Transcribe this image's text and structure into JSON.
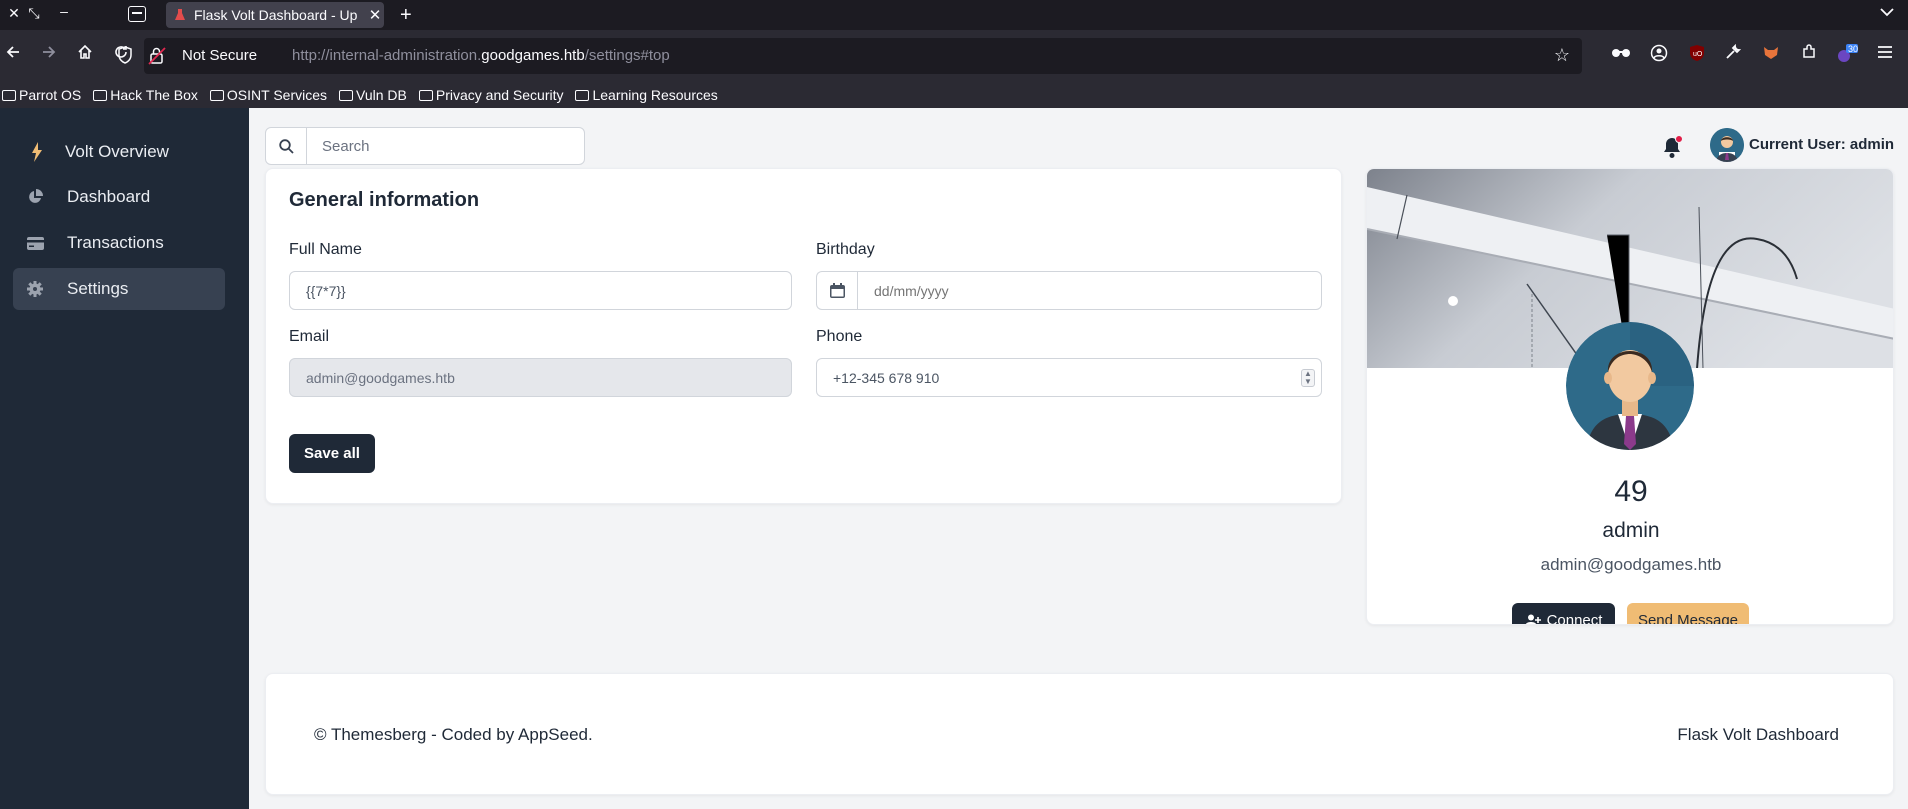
{
  "browser": {
    "tab_title": "Flask Volt Dashboard - Up",
    "security_label": "Not Secure",
    "url_prefix": "http://internal-administration.",
    "url_domain": "goodgames.htb",
    "url_suffix": "/settings#top",
    "extension_badge": "30",
    "bookmarks": [
      "Parrot OS",
      "Hack The Box",
      "OSINT Services",
      "Vuln DB",
      "Privacy and Security",
      "Learning Resources"
    ]
  },
  "sidebar": {
    "brand": "Volt Overview",
    "items": [
      {
        "label": "Dashboard",
        "icon": "pie-chart-icon"
      },
      {
        "label": "Transactions",
        "icon": "credit-card-icon"
      },
      {
        "label": "Settings",
        "icon": "gear-icon",
        "active": true
      }
    ]
  },
  "topbar": {
    "search_placeholder": "Search",
    "current_user": "Current User: admin"
  },
  "general": {
    "title": "General information",
    "full_name_label": "Full Name",
    "full_name_value": "{{7*7}}",
    "birthday_label": "Birthday",
    "birthday_placeholder": "dd/mm/yyyy",
    "email_label": "Email",
    "email_value": "admin@goodgames.htb",
    "phone_label": "Phone",
    "phone_value": "+12-345 678 910",
    "save_label": "Save all"
  },
  "profile": {
    "count": "49",
    "name": "admin",
    "email": "admin@goodgames.htb",
    "connect_label": "Connect",
    "message_label": "Send Message"
  },
  "footer": {
    "copyright": "© Themesberg - Coded by AppSeed.",
    "brand": "Flask Volt Dashboard"
  },
  "colors": {
    "sidebar_bg": "#1f2937",
    "primary_btn": "#1f2937",
    "secondary_btn": "#f0bc74",
    "notification_dot": "#e11d48"
  }
}
